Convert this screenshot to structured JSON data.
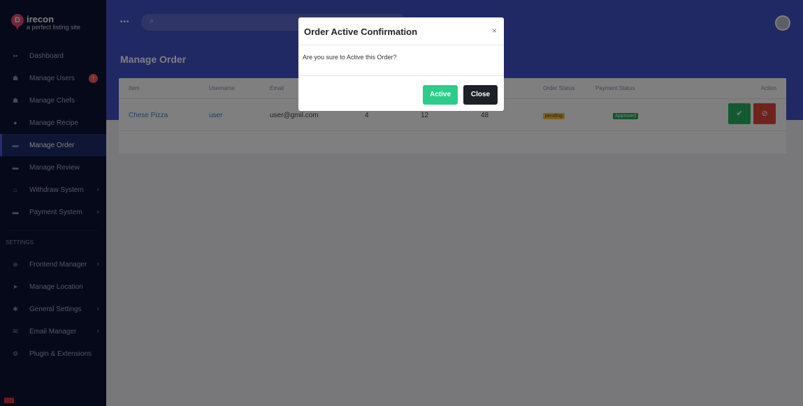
{
  "brand": {
    "logo_letter": "D",
    "name": "irecon",
    "tagline": "a perfect listing site"
  },
  "sidebar": {
    "items": [
      {
        "label": "Dashboard",
        "icon": "grid-icon"
      },
      {
        "label": "Manage Users",
        "icon": "users-icon",
        "badge": "!"
      },
      {
        "label": "Manage Chefs",
        "icon": "users-icon"
      },
      {
        "label": "Manage Recipe",
        "icon": "circle-icon"
      },
      {
        "label": "Manage Order",
        "icon": "list-icon"
      },
      {
        "label": "Manage Review",
        "icon": "list-icon"
      },
      {
        "label": "Withdraw System",
        "icon": "bank-icon"
      },
      {
        "label": "Payment System",
        "icon": "card-icon"
      }
    ],
    "settings_label": "SETTINGS",
    "settings_items": [
      {
        "label": "Frontend Manager",
        "icon": "globe-icon"
      },
      {
        "label": "Manage Location",
        "icon": "location-icon"
      },
      {
        "label": "General Settings",
        "icon": "gear-icon"
      },
      {
        "label": "Email Manager",
        "icon": "mail-icon"
      },
      {
        "label": "Plugin & Extensions",
        "icon": "gears-icon"
      }
    ]
  },
  "header": {
    "page_title": "Manage Order",
    "search_placeholder": ""
  },
  "table": {
    "headers": [
      "Item",
      "Username",
      "Email",
      "Order Status",
      "Payment Status",
      "Action"
    ],
    "row": {
      "item": "Chese Pizza",
      "username": "user",
      "email": "user@gmil.com",
      "qty": "4",
      "price": "12",
      "total": "48",
      "order_status": "pending",
      "payment_status": "Approved"
    }
  },
  "modal": {
    "title": "Order Active Confirmation",
    "close_glyph": "×",
    "message": "Are you sure to Active this Order?",
    "active_label": "Active",
    "close_label": "Close"
  },
  "colors": {
    "sidebar": "#0c1233",
    "accent": "#4353c9",
    "success": "#28b463",
    "danger": "#e0463a"
  }
}
